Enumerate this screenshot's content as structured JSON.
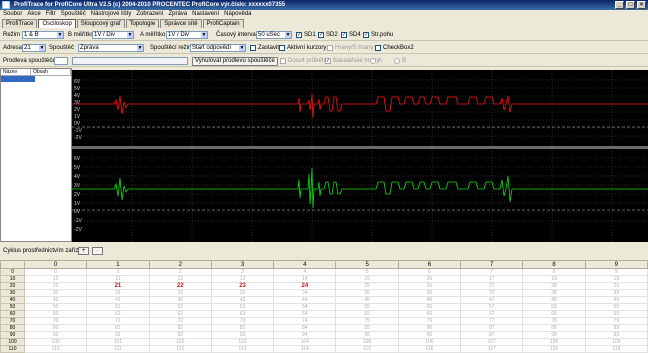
{
  "window": {
    "title": "ProfiTrace for ProfiCore Ultra V2.5 (c) 2004-2010 PROCENTEC  ProfiCore výr.číslo: xxxxxx07355"
  },
  "menu": [
    "Soubor",
    "Akce",
    "Filtr",
    "Spouštěč",
    "Nástrojové lišty",
    "Zobrazení",
    "Zpráva",
    "Nastavení",
    "Nápověda"
  ],
  "tabs": [
    "ProfiTrace",
    "Osciloskop",
    "Sloupcový graf",
    "Topologie",
    "Správce sítě",
    "ProfiCaptain"
  ],
  "active_tab": 1,
  "controls": {
    "rezim_label": "Režim",
    "rezim_value": "1 & B",
    "bmeritko_label": "B měřítko",
    "bmeritko_value": "1V / Div",
    "ameritko_label": "A měřítko",
    "ameritko_value": "1V / Div",
    "casovy_label": "Časový interval",
    "casovy_value": "50 uSec",
    "sd1": "SD1",
    "sd2": "SD2",
    "sd4": "SD4",
    "strpohu": "Str.pohu",
    "adresa_label": "Adresa",
    "adresa_value": "21",
    "spoustec_label": "Spouštěč",
    "spoustec_value": "Zpráva",
    "spoustrezim_label": "Spouštěcí režim",
    "spoustrezim_value": "Start odpovědí",
    "zastavit": "Zastavit",
    "aktivni": "Aktivní kurzory",
    "hrany": "Hrany/S.hrany",
    "checkbox2": "CheckBox2",
    "prodleva_label": "Prodleva spouštěče",
    "vynulovat": "Vynulovat prodlevu spouštěče",
    "dosvit": "Dosvit průběhu",
    "bakalar": "Bakalářské hrany",
    "radio_a": "A",
    "radio_b": "B"
  },
  "sidepanel": {
    "col1": "Název",
    "col2": "Obsah"
  },
  "scope": {
    "top_labels": [
      "6V",
      "5V",
      "4V",
      "3V",
      "2V",
      "1V",
      "0V",
      "-1V",
      "-2V"
    ],
    "bottom_labels": [
      "6V",
      "5V",
      "4V",
      "3V",
      "2V",
      "1V",
      "0V",
      "-1V",
      "-2V"
    ],
    "colors": {
      "channel_a": "#ff1010",
      "channel_b": "#10e010",
      "grid": "#5a5a5a",
      "background": "#000000"
    }
  },
  "table_bar": {
    "label": "Cyklus prostřednictvím zařízení",
    "plus": "+",
    "minus": "-"
  },
  "table": {
    "headers": [
      "",
      "0",
      "1",
      "2",
      "3",
      "4",
      "5",
      "6",
      "7",
      "8",
      "9"
    ],
    "rows": [
      [
        "0",
        "0",
        "1",
        "2",
        "3",
        "4",
        "5",
        "6",
        "7",
        "8",
        "9"
      ],
      [
        "10",
        "10",
        "11",
        "12",
        "13",
        "14",
        "15",
        "16",
        "17",
        "18",
        "19"
      ],
      [
        "20",
        "20",
        "21",
        "22",
        "23",
        "24",
        "25",
        "26",
        "27",
        "28",
        "29"
      ],
      [
        "30",
        "30",
        "31",
        "32",
        "33",
        "34",
        "35",
        "36",
        "37",
        "38",
        "39"
      ],
      [
        "40",
        "40",
        "41",
        "42",
        "43",
        "44",
        "45",
        "46",
        "47",
        "48",
        "49"
      ],
      [
        "50",
        "50",
        "51",
        "52",
        "53",
        "54",
        "55",
        "56",
        "57",
        "58",
        "59"
      ],
      [
        "60",
        "60",
        "61",
        "62",
        "63",
        "64",
        "65",
        "66",
        "67",
        "68",
        "69"
      ],
      [
        "70",
        "70",
        "71",
        "72",
        "73",
        "74",
        "75",
        "76",
        "77",
        "78",
        "79"
      ],
      [
        "80",
        "80",
        "81",
        "82",
        "83",
        "84",
        "85",
        "86",
        "87",
        "88",
        "89"
      ],
      [
        "90",
        "90",
        "91",
        "92",
        "93",
        "94",
        "95",
        "96",
        "97",
        "98",
        "99"
      ],
      [
        "100",
        "100",
        "101",
        "102",
        "103",
        "104",
        "105",
        "106",
        "107",
        "108",
        "109"
      ],
      [
        "110",
        "110",
        "111",
        "112",
        "113",
        "114",
        "115",
        "116",
        "117",
        "118",
        "119"
      ]
    ],
    "highlighted": [
      "21",
      "22",
      "23",
      "24"
    ]
  }
}
